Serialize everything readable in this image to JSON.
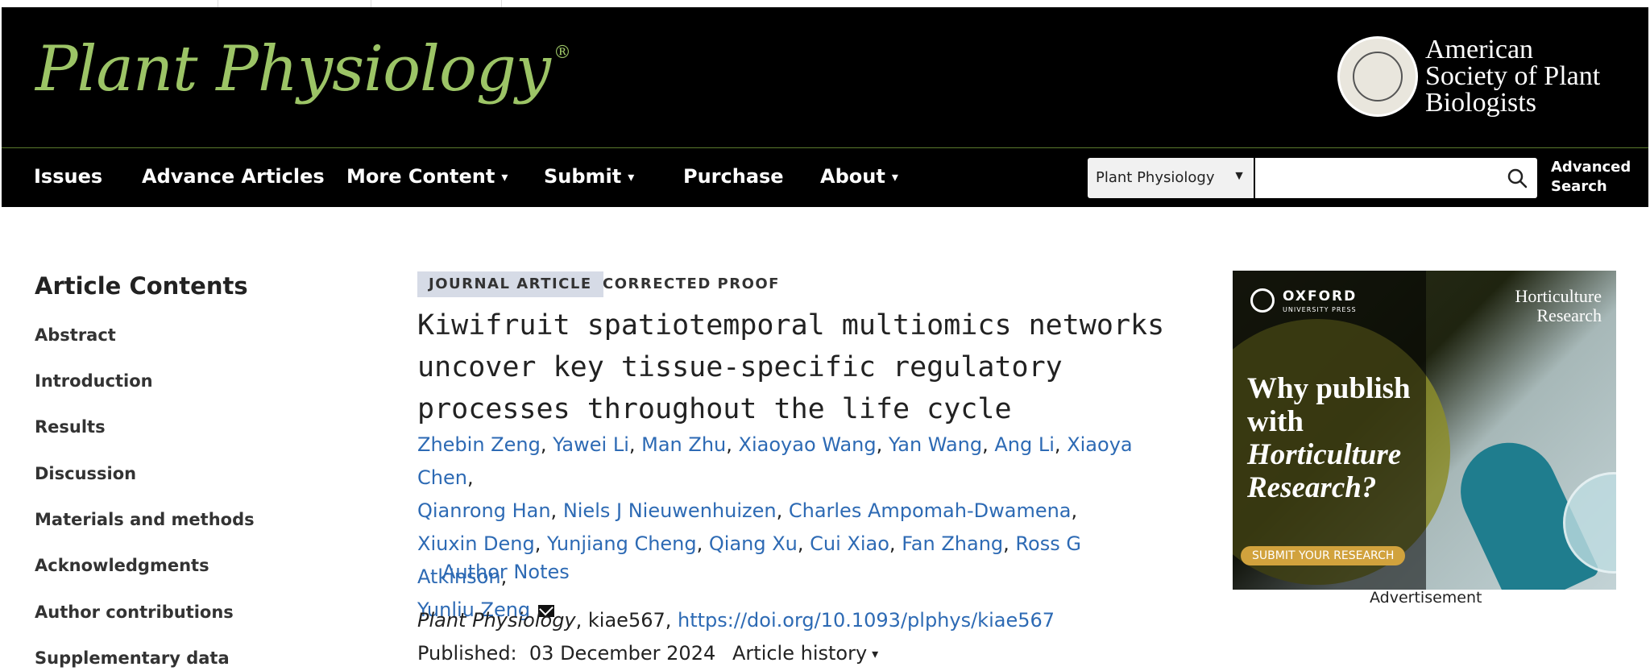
{
  "journal": {
    "name": "Plant Physiology",
    "registered_mark": "®"
  },
  "society": {
    "line1": "American",
    "line2": "Society of Plant",
    "line3": "Biologists"
  },
  "nav": {
    "items": [
      {
        "label": "Issues",
        "dropdown": false
      },
      {
        "label": "Advance Articles",
        "dropdown": false
      },
      {
        "label": "More Content",
        "dropdown": true
      },
      {
        "label": "Submit",
        "dropdown": true
      },
      {
        "label": "Purchase",
        "dropdown": false
      },
      {
        "label": "About",
        "dropdown": true
      }
    ],
    "caret": "▾"
  },
  "search": {
    "scope_selected": "Plant Physiology",
    "scope_arrow": "▼",
    "placeholder": "",
    "advanced_line1": "Advanced",
    "advanced_line2": "Search"
  },
  "toc": {
    "title": "Article Contents",
    "items": [
      "Abstract",
      "Introduction",
      "Results",
      "Discussion",
      "Materials and methods",
      "Acknowledgments",
      "Author contributions",
      "Supplementary data"
    ]
  },
  "article": {
    "type_badge": "JOURNAL ARTICLE",
    "status": "CORRECTED PROOF",
    "title_lines": [
      "Kiwifruit spatiotemporal multiomics networks",
      "uncover key tissue-specific regulatory",
      "processes throughout the life cycle"
    ],
    "authors": [
      "Zhebin Zeng",
      "Yawei Li",
      "Man Zhu",
      "Xiaoyao Wang",
      "Yan Wang",
      "Ang Li",
      "Xiaoya Chen",
      "Qianrong Han",
      "Niels J Nieuwenhuizen",
      "Charles Ampomah-Dwamena",
      "Xiuxin Deng",
      "Yunjiang Cheng",
      "Qiang Xu",
      "Cui Xiao",
      "Fan Zhang",
      "Ross G Atkinson",
      "Yunliu Zeng"
    ],
    "author_notes": "Author Notes",
    "citation_journal": "Plant Physiology",
    "citation_id": ", kiae567, ",
    "doi": "https://doi.org/10.1093/plphys/kiae567",
    "published_label": "Published:",
    "published_date": "03 December 2024",
    "history_label": "Article history"
  },
  "ad": {
    "publisher": "OXFORD",
    "publisher_sub": "UNIVERSITY PRESS",
    "brand_line1": "Horticulture",
    "brand_line2": "Research",
    "headline_line1": "Why publish",
    "headline_line2": "with",
    "headline_line3": "Horticulture",
    "headline_line4": "Research?",
    "cta": "SUBMIT YOUR RESEARCH",
    "label": "Advertisement"
  },
  "colors": {
    "accent_green": "#9cc466",
    "link_blue": "#2d6ab4",
    "badge_bg": "#d6dbe6"
  }
}
